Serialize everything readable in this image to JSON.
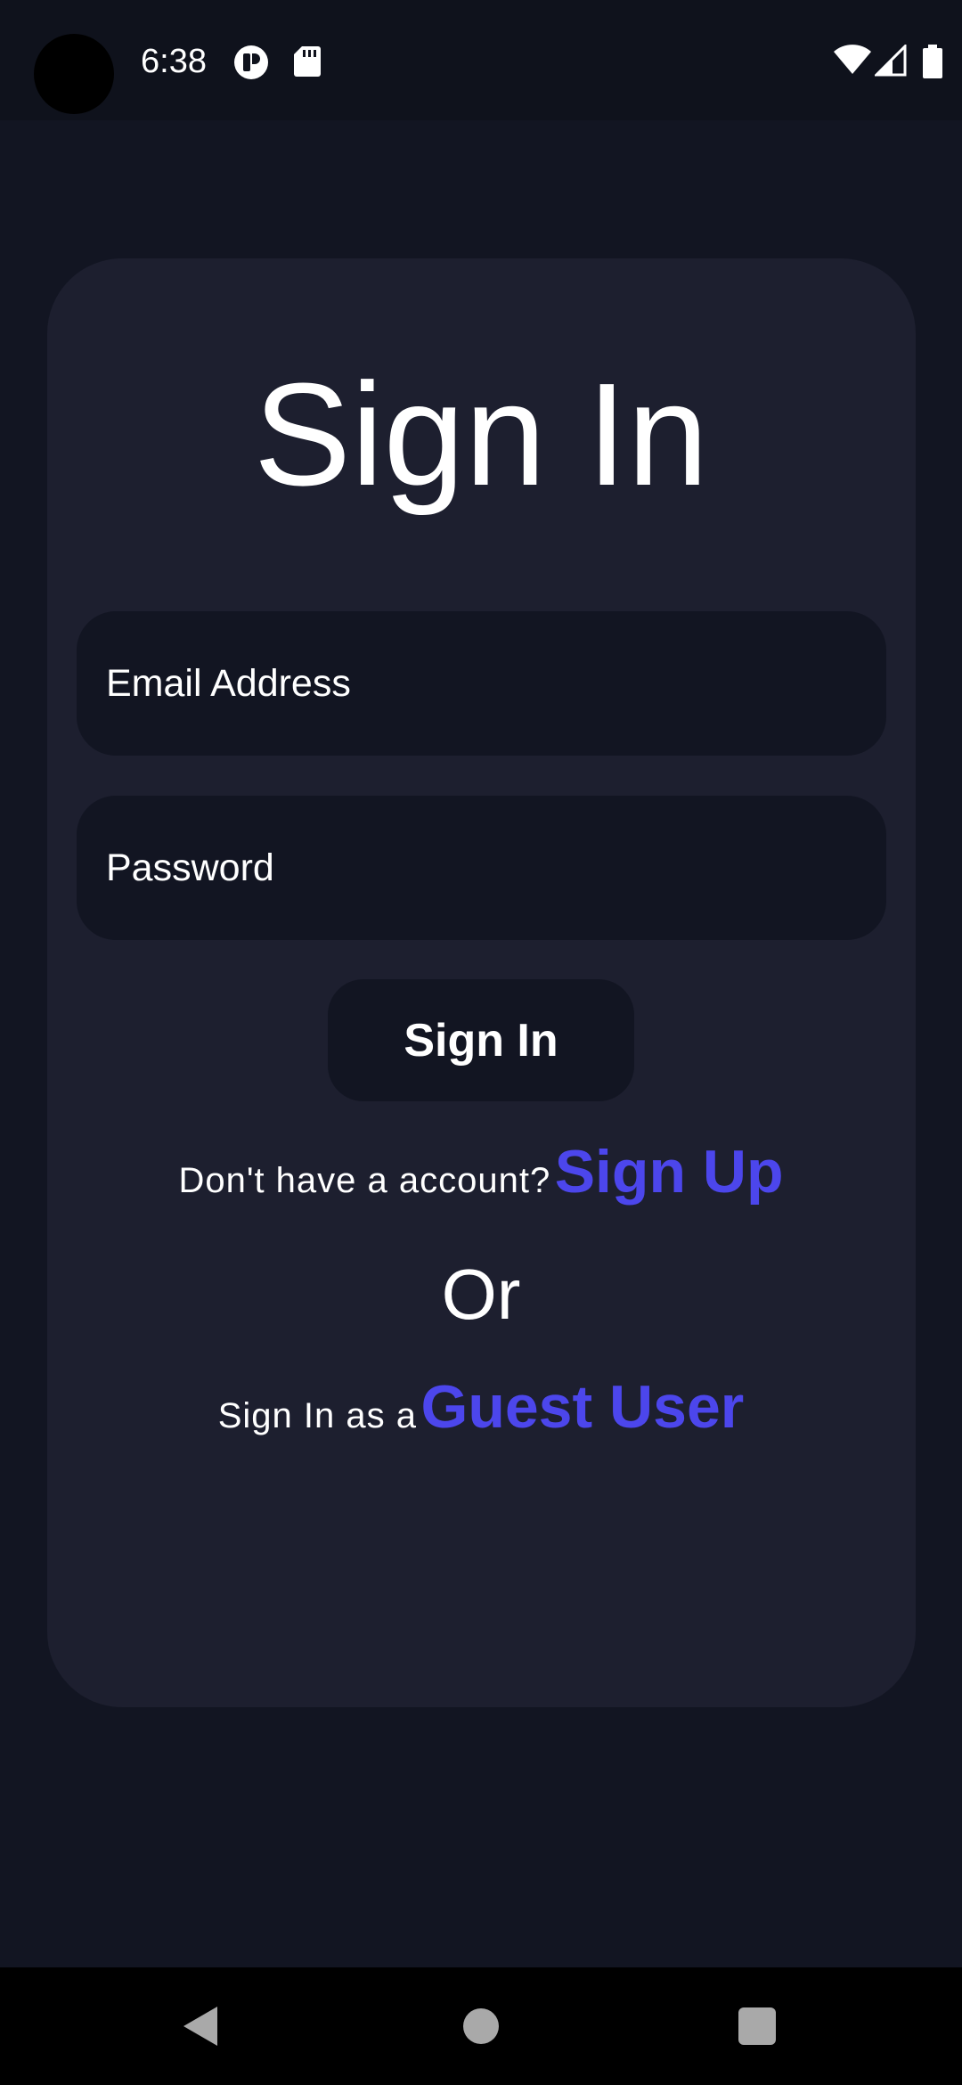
{
  "status_bar": {
    "time": "6:38",
    "icons": [
      "app-notification-icon",
      "sd-card-icon",
      "wifi-icon",
      "cell-signal-icon",
      "battery-icon"
    ]
  },
  "signin_form": {
    "title": "Sign In",
    "email_placeholder": "Email Address",
    "password_placeholder": "Password",
    "submit_label": "Sign In",
    "signup_prompt": "Don't have a account?",
    "signup_link": "Sign Up",
    "or_text": "Or",
    "guest_prompt": "Sign In as a",
    "guest_link": "Guest User"
  },
  "nav_bar": {
    "icons": [
      "back-icon",
      "home-icon",
      "recents-icon"
    ]
  },
  "colors": {
    "background": "#121522",
    "card": "#1d1f2f",
    "field": "#121522",
    "accent_link": "#4c46ec",
    "text": "#ffffff"
  }
}
